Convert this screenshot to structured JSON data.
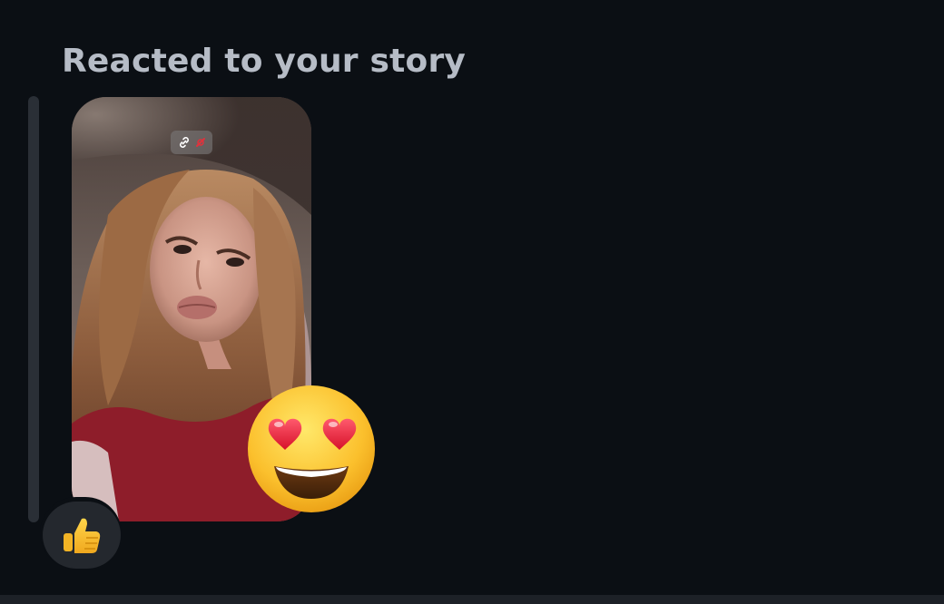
{
  "message": {
    "heading": "Reacted to your story"
  },
  "story": {
    "content": "story-preview-image",
    "badge_icons": [
      "link-icon",
      "muted-link-icon"
    ]
  },
  "reactions": {
    "story_reaction": "heart-eyes-emoji",
    "message_reaction": "thumbs-up-emoji"
  },
  "colors": {
    "background": "#0b0f14",
    "heading": "#b6bcc6",
    "reply_line": "#2a2f36",
    "reaction_bubble": "#24282e"
  }
}
